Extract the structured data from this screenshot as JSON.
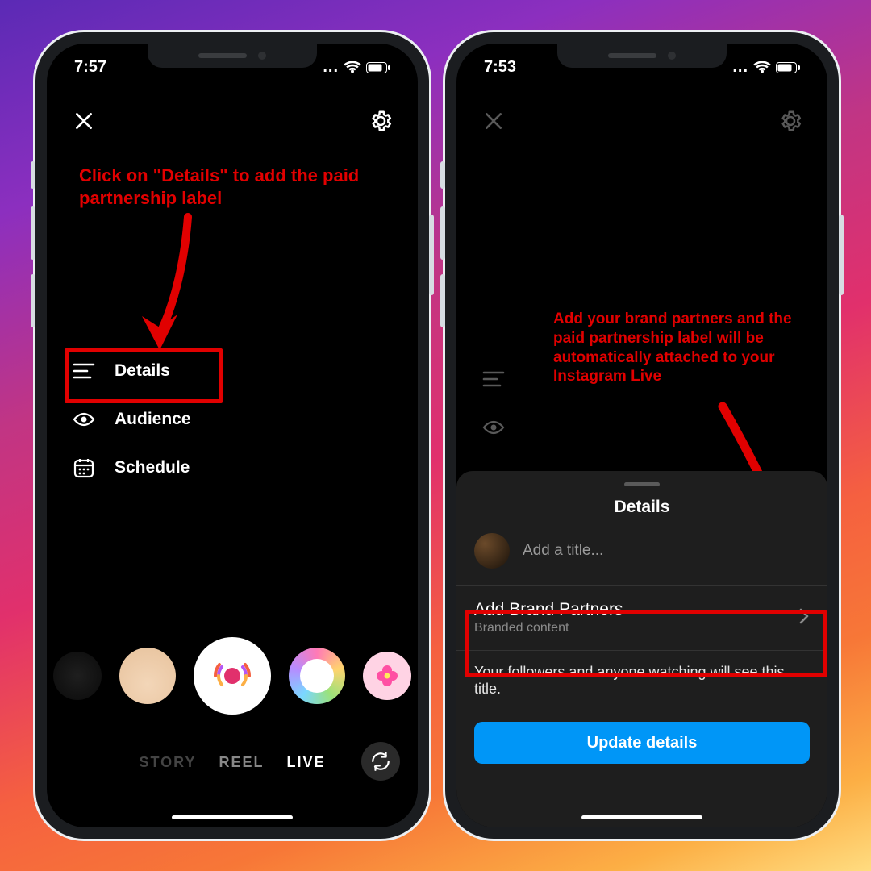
{
  "phone_left": {
    "status_time": "7:57",
    "annotation": "Click on \"Details\" to add the paid partnership label",
    "menu": {
      "details": "Details",
      "audience": "Audience",
      "schedule": "Schedule"
    },
    "modes": {
      "story": "STORY",
      "reel": "REEL",
      "live": "LIVE"
    }
  },
  "phone_right": {
    "status_time": "7:53",
    "annotation": "Add your brand partners and the paid partnership label will be automatically attached to your Instagram Live",
    "sheet": {
      "title": "Details",
      "title_placeholder": "Add a title...",
      "brand_title": "Add Brand Partners",
      "brand_subtitle": "Branded content",
      "note": "Your followers and anyone watching will see this title.",
      "update_btn": "Update details"
    }
  },
  "icons": {
    "signal": "...",
    "wifi": "wifi-icon",
    "battery": "battery-icon"
  }
}
